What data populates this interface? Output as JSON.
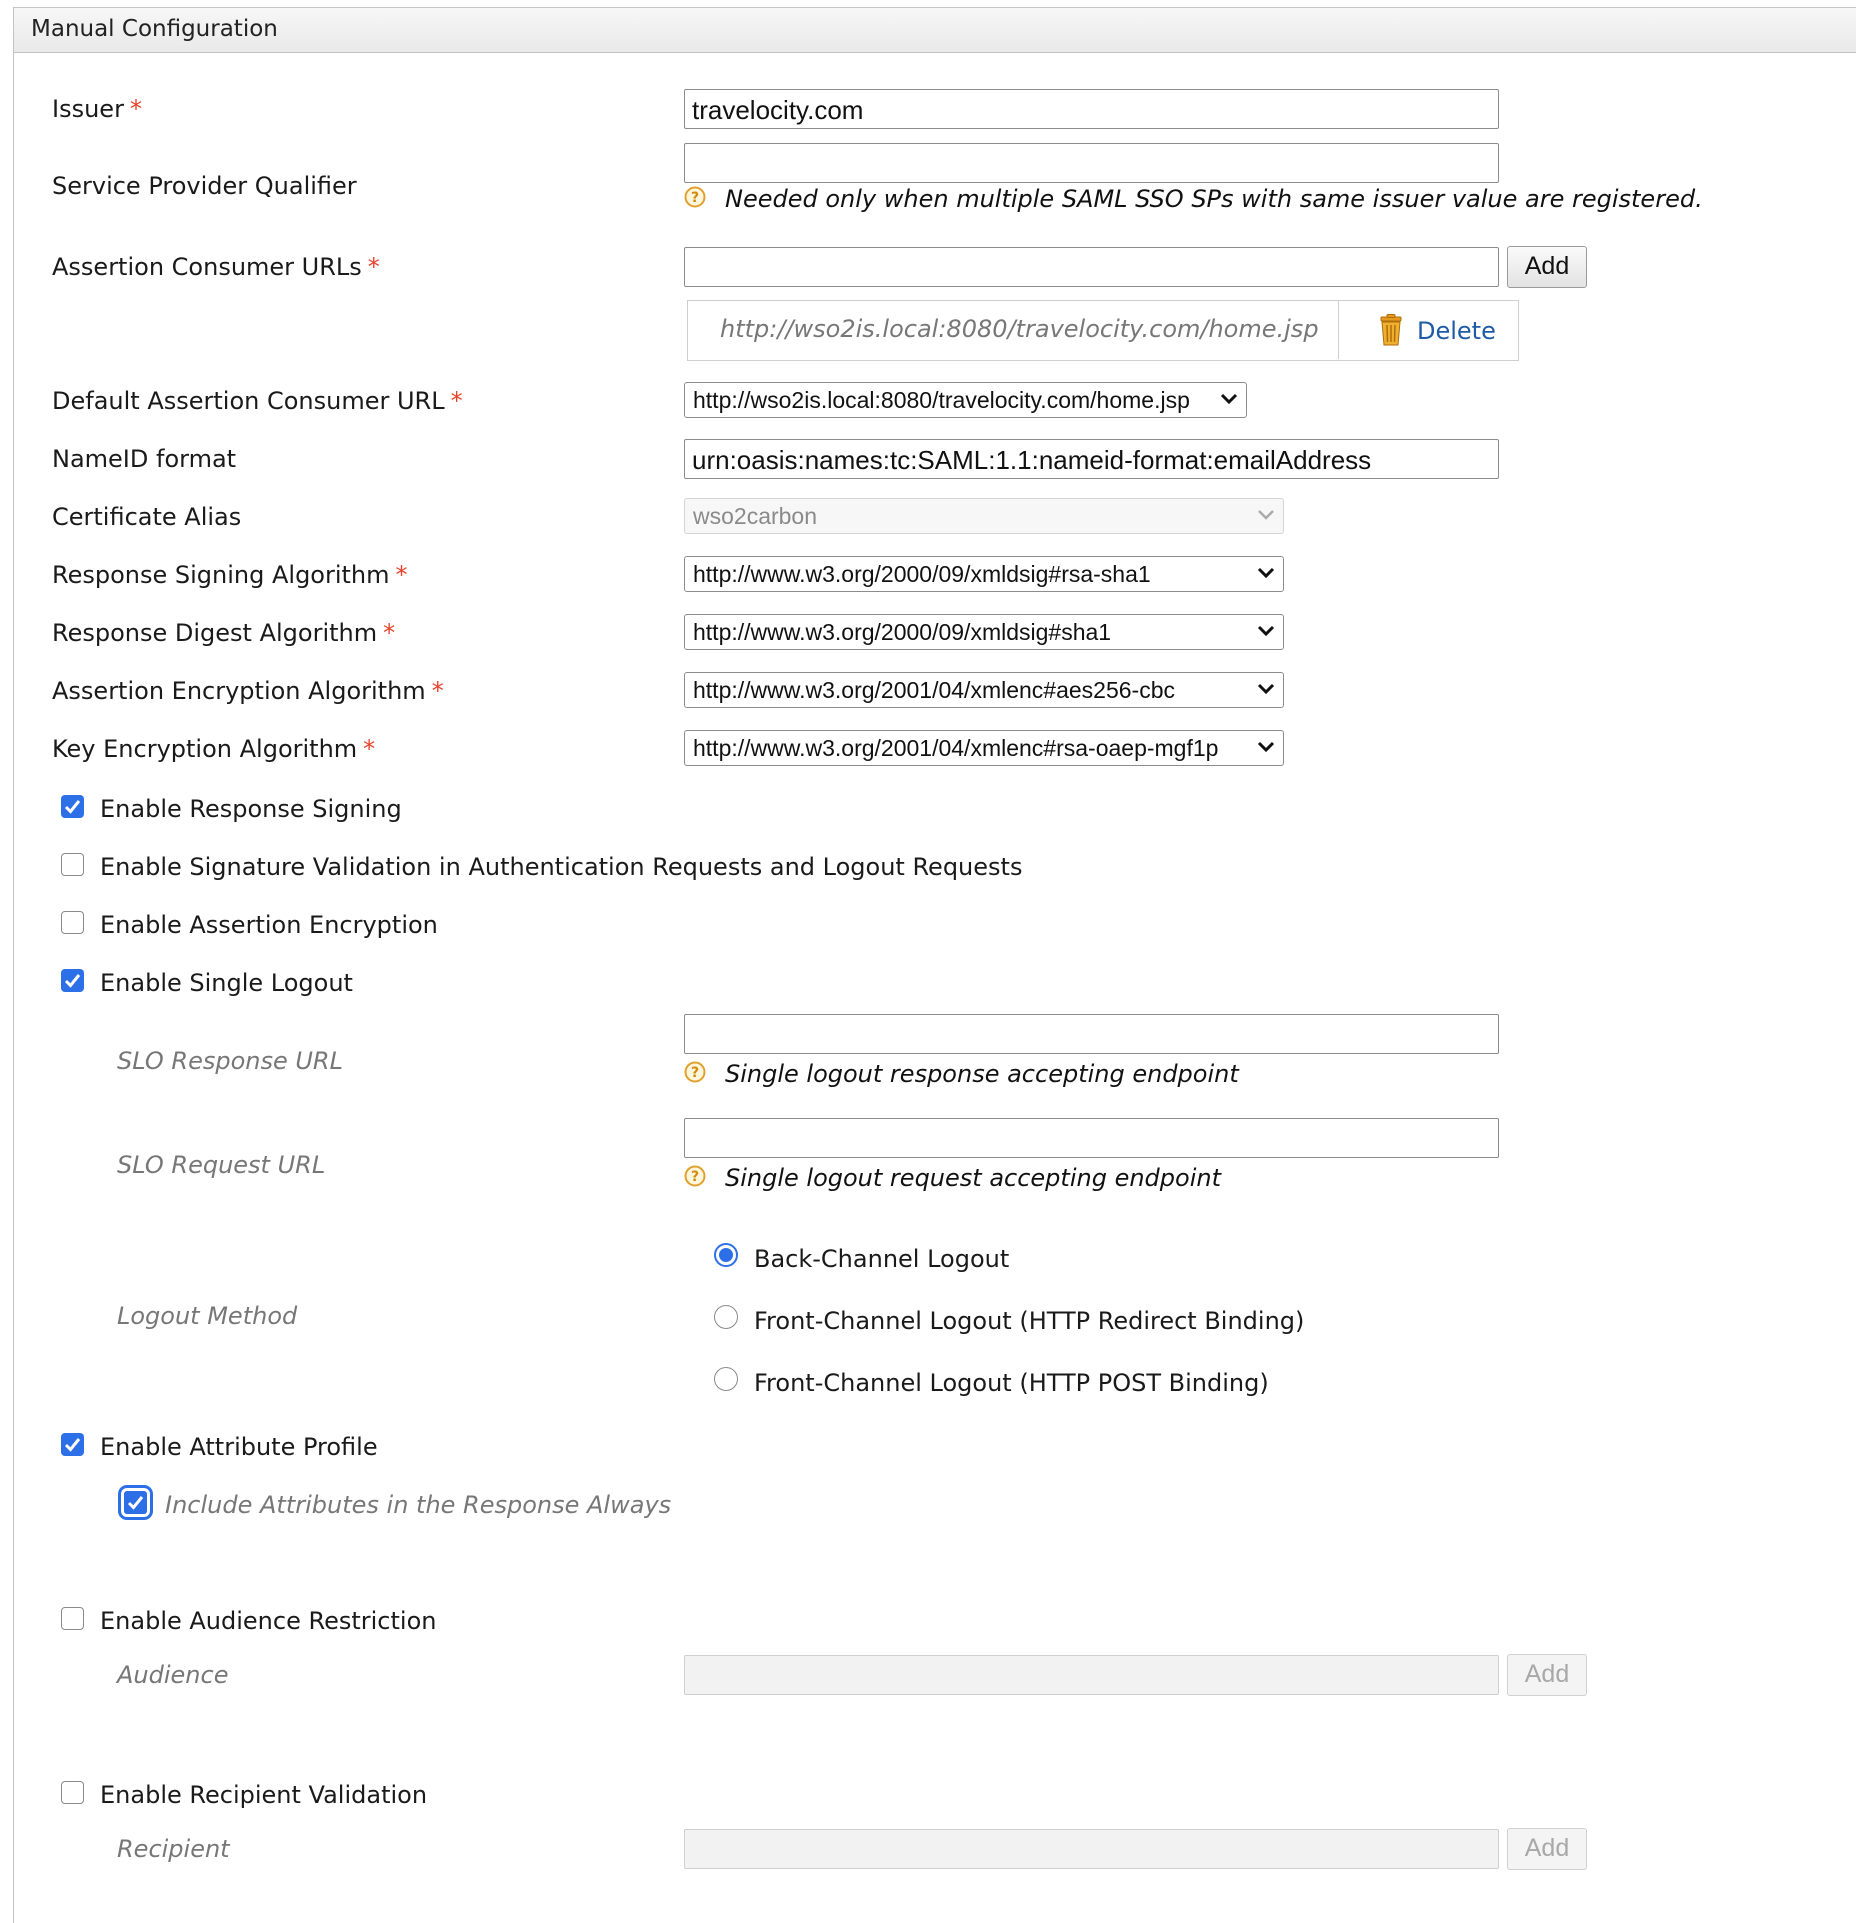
{
  "panel": {
    "title": "Manual Configuration"
  },
  "fields": {
    "issuer": {
      "label": "Issuer",
      "required": "*",
      "value": "travelocity.com"
    },
    "sp_qualifier": {
      "label": "Service Provider Qualifier",
      "value": "",
      "help": "Needed only when multiple SAML SSO SPs with same issuer value are registered."
    },
    "acs_urls": {
      "label": "Assertion Consumer URLs",
      "required": "*",
      "value": "",
      "add_label": "Add",
      "urls": [
        "http://wso2is.local:8080/travelocity.com/home.jsp"
      ],
      "delete_label": "Delete"
    },
    "default_acs": {
      "label": "Default Assertion Consumer URL",
      "required": "*",
      "value": "http://wso2is.local:8080/travelocity.com/home.jsp"
    },
    "nameid_format": {
      "label": "NameID format",
      "value": "urn:oasis:names:tc:SAML:1.1:nameid-format:emailAddress"
    },
    "cert_alias": {
      "label": "Certificate Alias",
      "value": "wso2carbon",
      "disabled": true
    },
    "resp_sign_alg": {
      "label": "Response Signing Algorithm",
      "required": "*",
      "value": "http://www.w3.org/2000/09/xmldsig#rsa-sha1"
    },
    "resp_digest_alg": {
      "label": "Response Digest Algorithm",
      "required": "*",
      "value": "http://www.w3.org/2000/09/xmldsig#sha1"
    },
    "assert_enc_alg": {
      "label": "Assertion Encryption Algorithm",
      "required": "*",
      "value": "http://www.w3.org/2001/04/xmlenc#aes256-cbc"
    },
    "key_enc_alg": {
      "label": "Key Encryption Algorithm",
      "required": "*",
      "value": "http://www.w3.org/2001/04/xmlenc#rsa-oaep-mgf1p"
    }
  },
  "checks": {
    "response_signing": {
      "label": "Enable Response Signing",
      "checked": true
    },
    "signature_validation": {
      "label": "Enable Signature Validation in Authentication Requests and Logout Requests",
      "checked": false
    },
    "assertion_encryption": {
      "label": "Enable Assertion Encryption",
      "checked": false
    },
    "single_logout": {
      "label": "Enable Single Logout",
      "checked": true
    },
    "attribute_profile": {
      "label": "Enable Attribute Profile",
      "checked": true
    },
    "include_attributes": {
      "label": "Include Attributes in the Response Always",
      "checked": true
    },
    "audience_restriction": {
      "label": "Enable Audience Restriction",
      "checked": false
    },
    "recipient_validation": {
      "label": "Enable Recipient Validation",
      "checked": false
    }
  },
  "slo": {
    "response_url": {
      "label": "SLO Response URL",
      "value": "",
      "help": "Single logout response accepting endpoint"
    },
    "request_url": {
      "label": "SLO Request URL",
      "value": "",
      "help": "Single logout request accepting endpoint"
    },
    "logout_method": {
      "label": "Logout Method",
      "options": [
        {
          "label": "Back-Channel Logout",
          "selected": true
        },
        {
          "label": "Front-Channel Logout (HTTP Redirect Binding)",
          "selected": false
        },
        {
          "label": "Front-Channel Logout (HTTP POST Binding)",
          "selected": false
        }
      ]
    }
  },
  "audience": {
    "label": "Audience",
    "value": "",
    "add_label": "Add",
    "disabled": true
  },
  "recipient": {
    "label": "Recipient",
    "value": "",
    "add_label": "Add",
    "disabled": true
  },
  "colors": {
    "accent": "#2c6fe6",
    "required": "#e8422a",
    "link": "#1f5aa6",
    "help_icon": "#e0a030"
  }
}
